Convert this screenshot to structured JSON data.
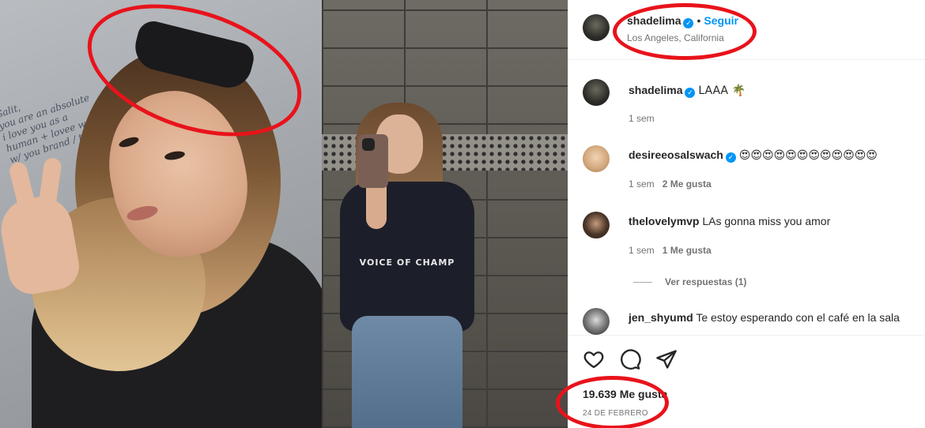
{
  "post": {
    "username": "shadelima",
    "follow_label": "Seguir",
    "separator": "•",
    "location": "Los Angeles, California",
    "verified_icon": "verified-badge-icon"
  },
  "caption": {
    "username": "shadelima",
    "text": "LAAA 🌴",
    "time": "1 sem"
  },
  "comments": [
    {
      "username": "desireeosalswach",
      "text": "😍😍😍😍😍😍😍😍😍😍😍😍",
      "time": "1 sem",
      "likes": "2 Me gusta",
      "verified": true
    },
    {
      "username": "thelovelymvp",
      "text": "LAs gonna miss you amor",
      "time": "1 sem",
      "likes": "1 Me gusta",
      "verified": false
    },
    {
      "username": "jen_shyumd",
      "text": "Te estoy esperando con el café en la sala",
      "verified": false
    }
  ],
  "view_replies": "Ver respuestas (1)",
  "actions": {
    "icons": [
      "heart-icon",
      "comment-icon",
      "share-icon"
    ],
    "likes": "19.639 Me gusta",
    "date": "24 DE FEBRERO"
  },
  "photo_texts": {
    "wall": [
      "Galit,",
      "you are an absolute",
      "i love you as a",
      "human + lovee working",
      "w/ you brand / team"
    ],
    "hoodie": "VOICE OF CHAMP"
  },
  "annotation_color": "#e8131b"
}
